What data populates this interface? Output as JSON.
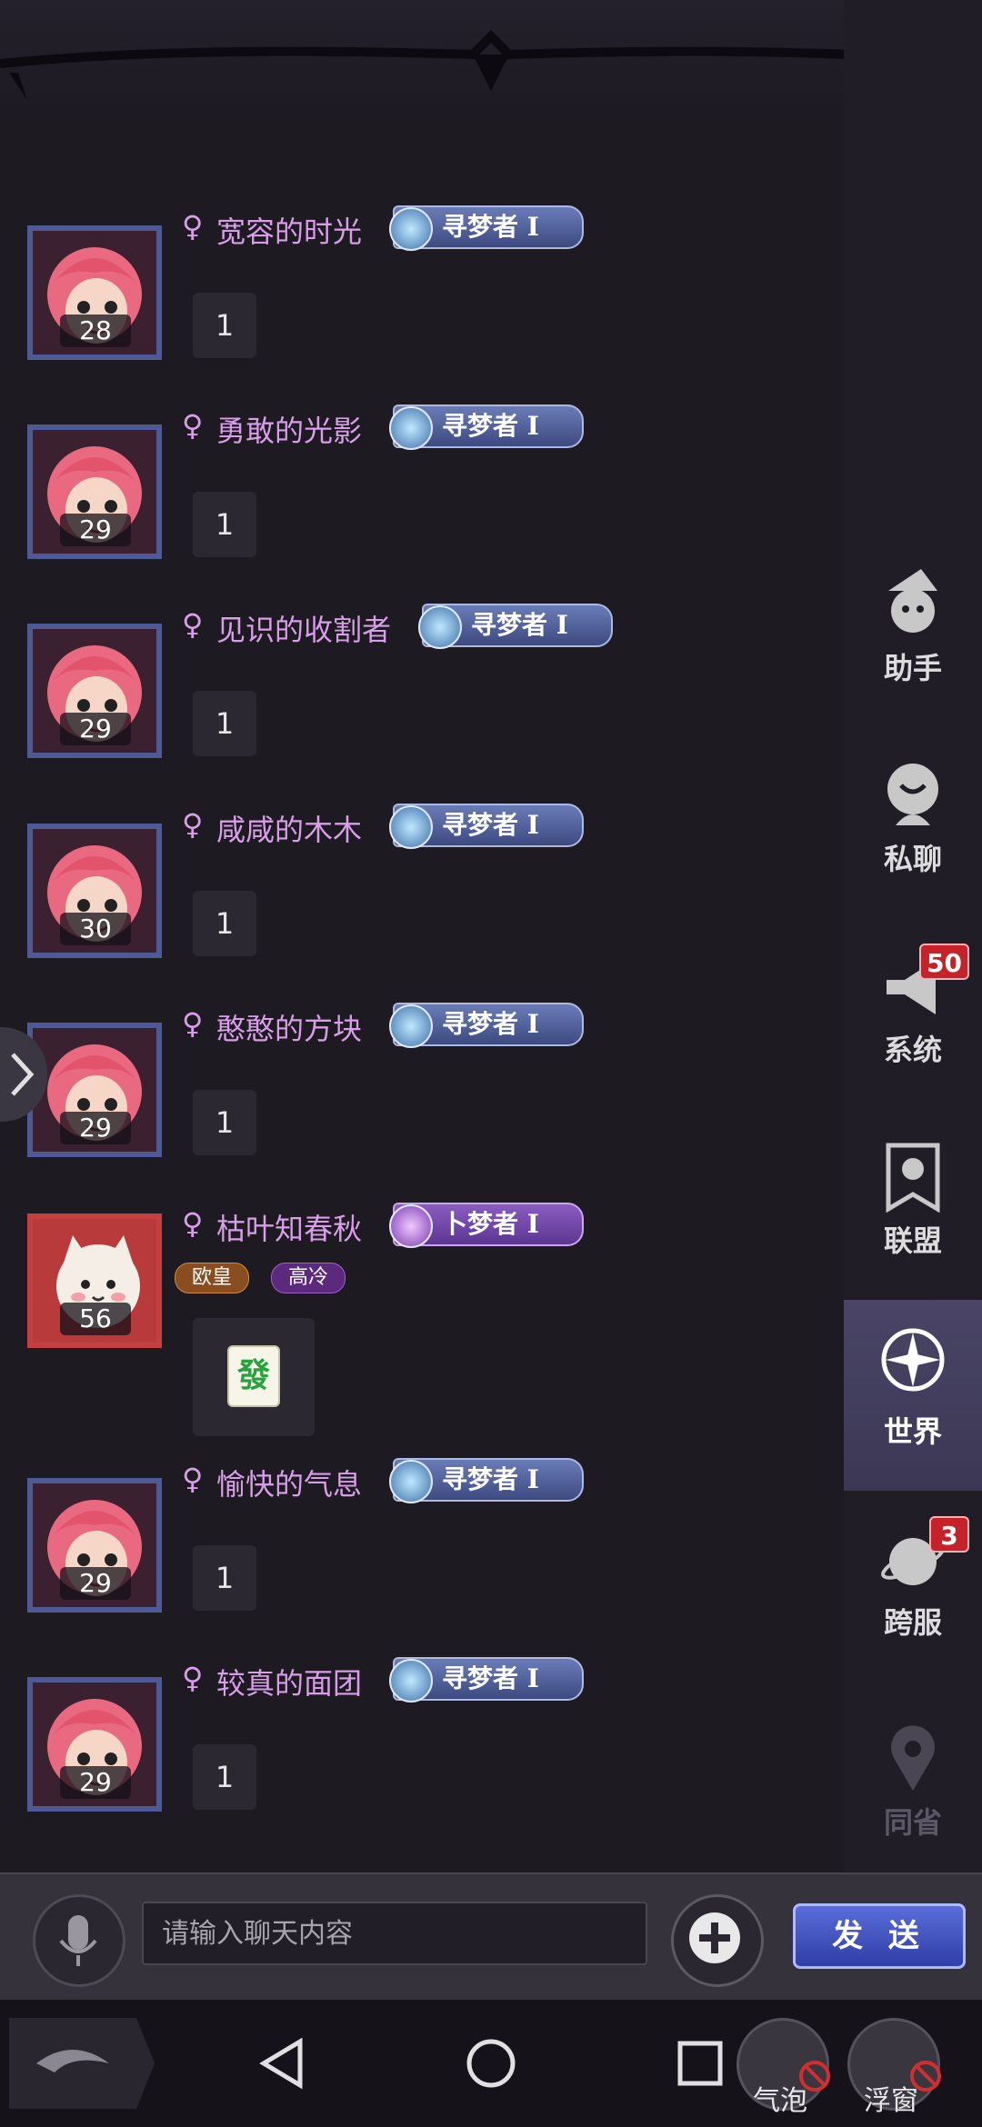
{
  "messages": [
    {
      "name": "宽容的时光",
      "gender": "♀",
      "level": "28",
      "rank": "寻梦者 I",
      "text": "1"
    },
    {
      "name": "勇敢的光影",
      "gender": "♀",
      "level": "29",
      "rank": "寻梦者 I",
      "text": "1"
    },
    {
      "name": "见识的收割者",
      "gender": "♀",
      "level": "29",
      "rank": "寻梦者 I",
      "text": "1"
    },
    {
      "name": "咸咸的木木",
      "gender": "♀",
      "level": "30",
      "rank": "寻梦者 I",
      "text": "1"
    },
    {
      "name": "憨憨的方块",
      "gender": "♀",
      "level": "29",
      "rank": "寻梦者 I",
      "text": "1"
    },
    {
      "name": "枯叶知春秋",
      "gender": "♀",
      "level": "56",
      "rank": "卜梦者 I",
      "tags": [
        "欧皇",
        "高冷"
      ],
      "tile": "發"
    },
    {
      "name": "愉快的气息",
      "gender": "♀",
      "level": "29",
      "rank": "寻梦者 I",
      "text": "1"
    },
    {
      "name": "较真的面团",
      "gender": "♀",
      "level": "29",
      "rank": "寻梦者 I",
      "text": "1"
    }
  ],
  "sidebar": [
    {
      "label": "助手",
      "icon": "assistant-icon"
    },
    {
      "label": "私聊",
      "icon": "private-chat-icon"
    },
    {
      "label": "系统",
      "icon": "megaphone-icon",
      "badge": "50"
    },
    {
      "label": "联盟",
      "icon": "banner-icon"
    },
    {
      "label": "世界",
      "icon": "compass-icon",
      "active": true
    },
    {
      "label": "跨服",
      "icon": "planet-icon",
      "badge": "3"
    },
    {
      "label": "同省",
      "icon": "location-pin-icon"
    }
  ],
  "input": {
    "placeholder": "请输入聊天内容"
  },
  "send_label": "发 送",
  "floating": {
    "bubble": "气泡",
    "window": "浮窗"
  },
  "colors": {
    "name": "#d89ee8",
    "rank_blue": "#4d5a96",
    "rank_purple": "#7a45b0",
    "send": "#3f4fc0",
    "badge": "#c6222a"
  }
}
